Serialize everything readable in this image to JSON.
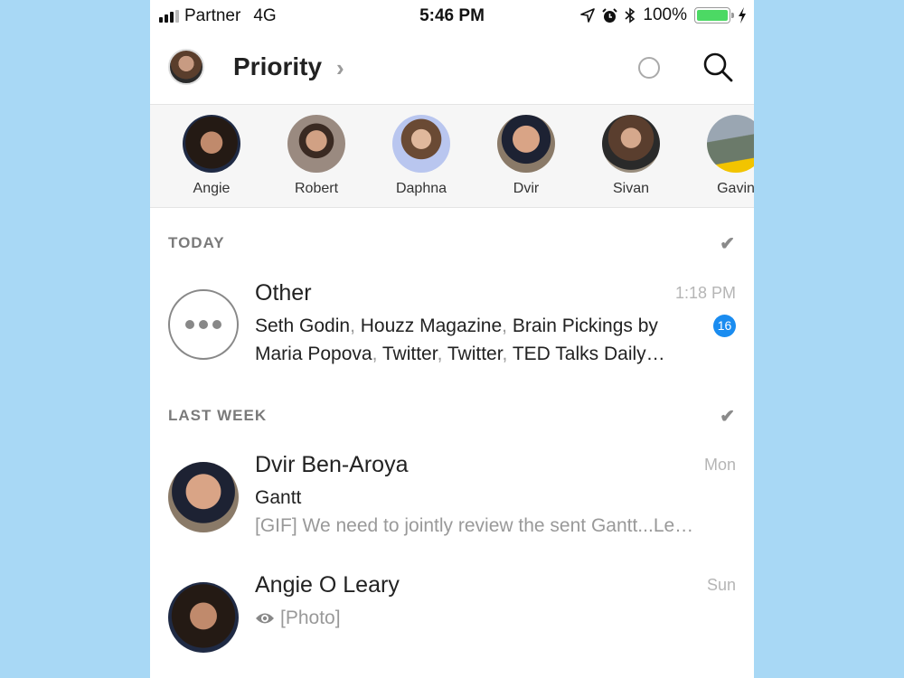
{
  "status_bar": {
    "carrier": "Partner",
    "network": "4G",
    "time": "5:46 PM",
    "battery": "100%",
    "battery_level": 1.0,
    "battery_color": "#4cd964",
    "icons": [
      "signal-icon",
      "location-icon",
      "alarm-icon",
      "bluetooth-icon",
      "battery-icon",
      "charging-icon"
    ]
  },
  "header": {
    "title": "Priority",
    "icons": [
      "profile-avatar",
      "chevron-right-icon",
      "circle-icon",
      "search-icon"
    ]
  },
  "favorites": [
    {
      "name": "Angie"
    },
    {
      "name": "Robert"
    },
    {
      "name": "Daphna"
    },
    {
      "name": "Dvir"
    },
    {
      "name": "Sivan"
    },
    {
      "name": "Gavin"
    }
  ],
  "sections": {
    "today": {
      "label": "TODAY",
      "items": [
        {
          "title": "Other",
          "time": "1:18 PM",
          "senders": [
            "Seth Godin",
            "Houzz Magazine",
            "Brain Pickings by Maria Popova",
            "Twitter",
            "Twitter",
            "TED Talks Daily…"
          ],
          "unread_count": "16",
          "badge_color": "#1a8cf0"
        }
      ]
    },
    "last_week": {
      "label": "LAST WEEK",
      "items": [
        {
          "title": "Dvir Ben-Aroya",
          "time": "Mon",
          "subject": "Gantt",
          "preview": "[GIF] We need to jointly review the sent Gantt...Le…"
        },
        {
          "title": "Angie O Leary",
          "time": "Sun",
          "preview": "[Photo]"
        }
      ]
    }
  }
}
